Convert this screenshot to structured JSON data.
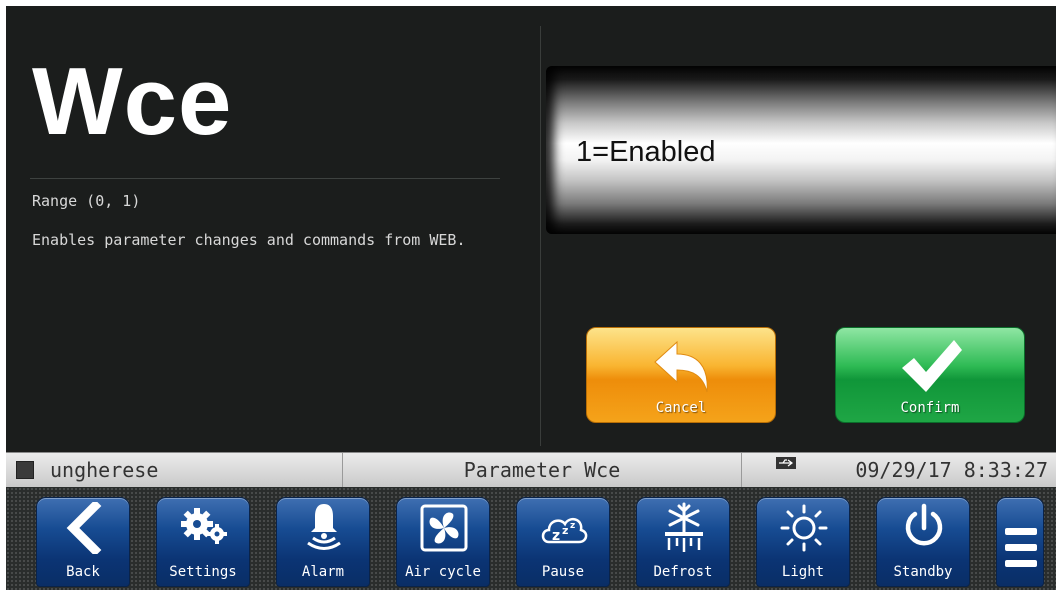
{
  "parameter": {
    "title": "Wce",
    "range": "Range (0, 1)",
    "description": "Enables parameter changes and commands from WEB."
  },
  "value_display": {
    "value": "1=Enabled"
  },
  "actions": {
    "cancel_label": "Cancel",
    "confirm_label": "Confirm"
  },
  "status_bar": {
    "left_label": "ungherese",
    "center_label": "Parameter Wce",
    "datetime": "09/29/17 8:33:27",
    "usb_icon": "usb-icon"
  },
  "toolbar": {
    "buttons": [
      {
        "label": "Back",
        "icon": "back-arrow-icon"
      },
      {
        "label": "Settings",
        "icon": "gears-icon"
      },
      {
        "label": "Alarm",
        "icon": "bell-icon"
      },
      {
        "label": "Air cycle",
        "icon": "fan-icon"
      },
      {
        "label": "Pause",
        "icon": "sleep-cloud-icon"
      },
      {
        "label": "Defrost",
        "icon": "snowflake-icon"
      },
      {
        "label": "Light",
        "icon": "sun-icon"
      },
      {
        "label": "Standby",
        "icon": "power-icon"
      }
    ],
    "menu_icon": "menu-icon"
  },
  "colors": {
    "background": "#1b1d1c",
    "cancel": "#f5a31a",
    "confirm": "#1fa645",
    "toolbar_button": "#174c93"
  }
}
